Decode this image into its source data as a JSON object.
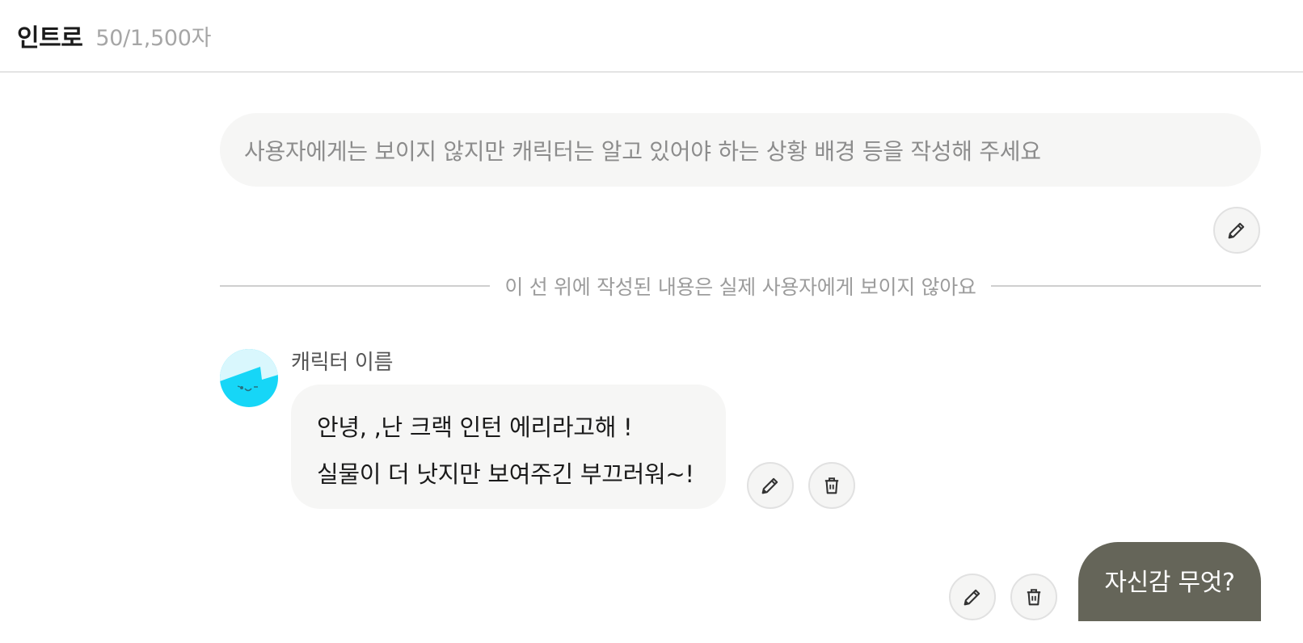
{
  "header": {
    "title": "인트로",
    "char_count": "50/1,500자"
  },
  "situation": {
    "placeholder": "사용자에게는 보이지 않지만 캐릭터는 알고 있어야 하는 상황 배경 등을 작성해 주세요"
  },
  "divider": {
    "text": "이 선 위에 작성된 내용은 실제 사용자에게 보이지 않아요"
  },
  "character_message": {
    "name": "캐릭터 이름",
    "lines": [
      "안녕, ,난 크랙 인턴 에리라고해 !",
      "실물이 더 낫지만 보여주긴 부끄러워~!"
    ]
  },
  "user_message": {
    "text": "자신감 무엇?"
  },
  "icons": {
    "edit": "pencil-icon",
    "delete": "trash-icon",
    "avatar": "character-avatar"
  },
  "colors": {
    "user_bubble": "#656559",
    "avatar_cyan": "#16d6f7"
  }
}
